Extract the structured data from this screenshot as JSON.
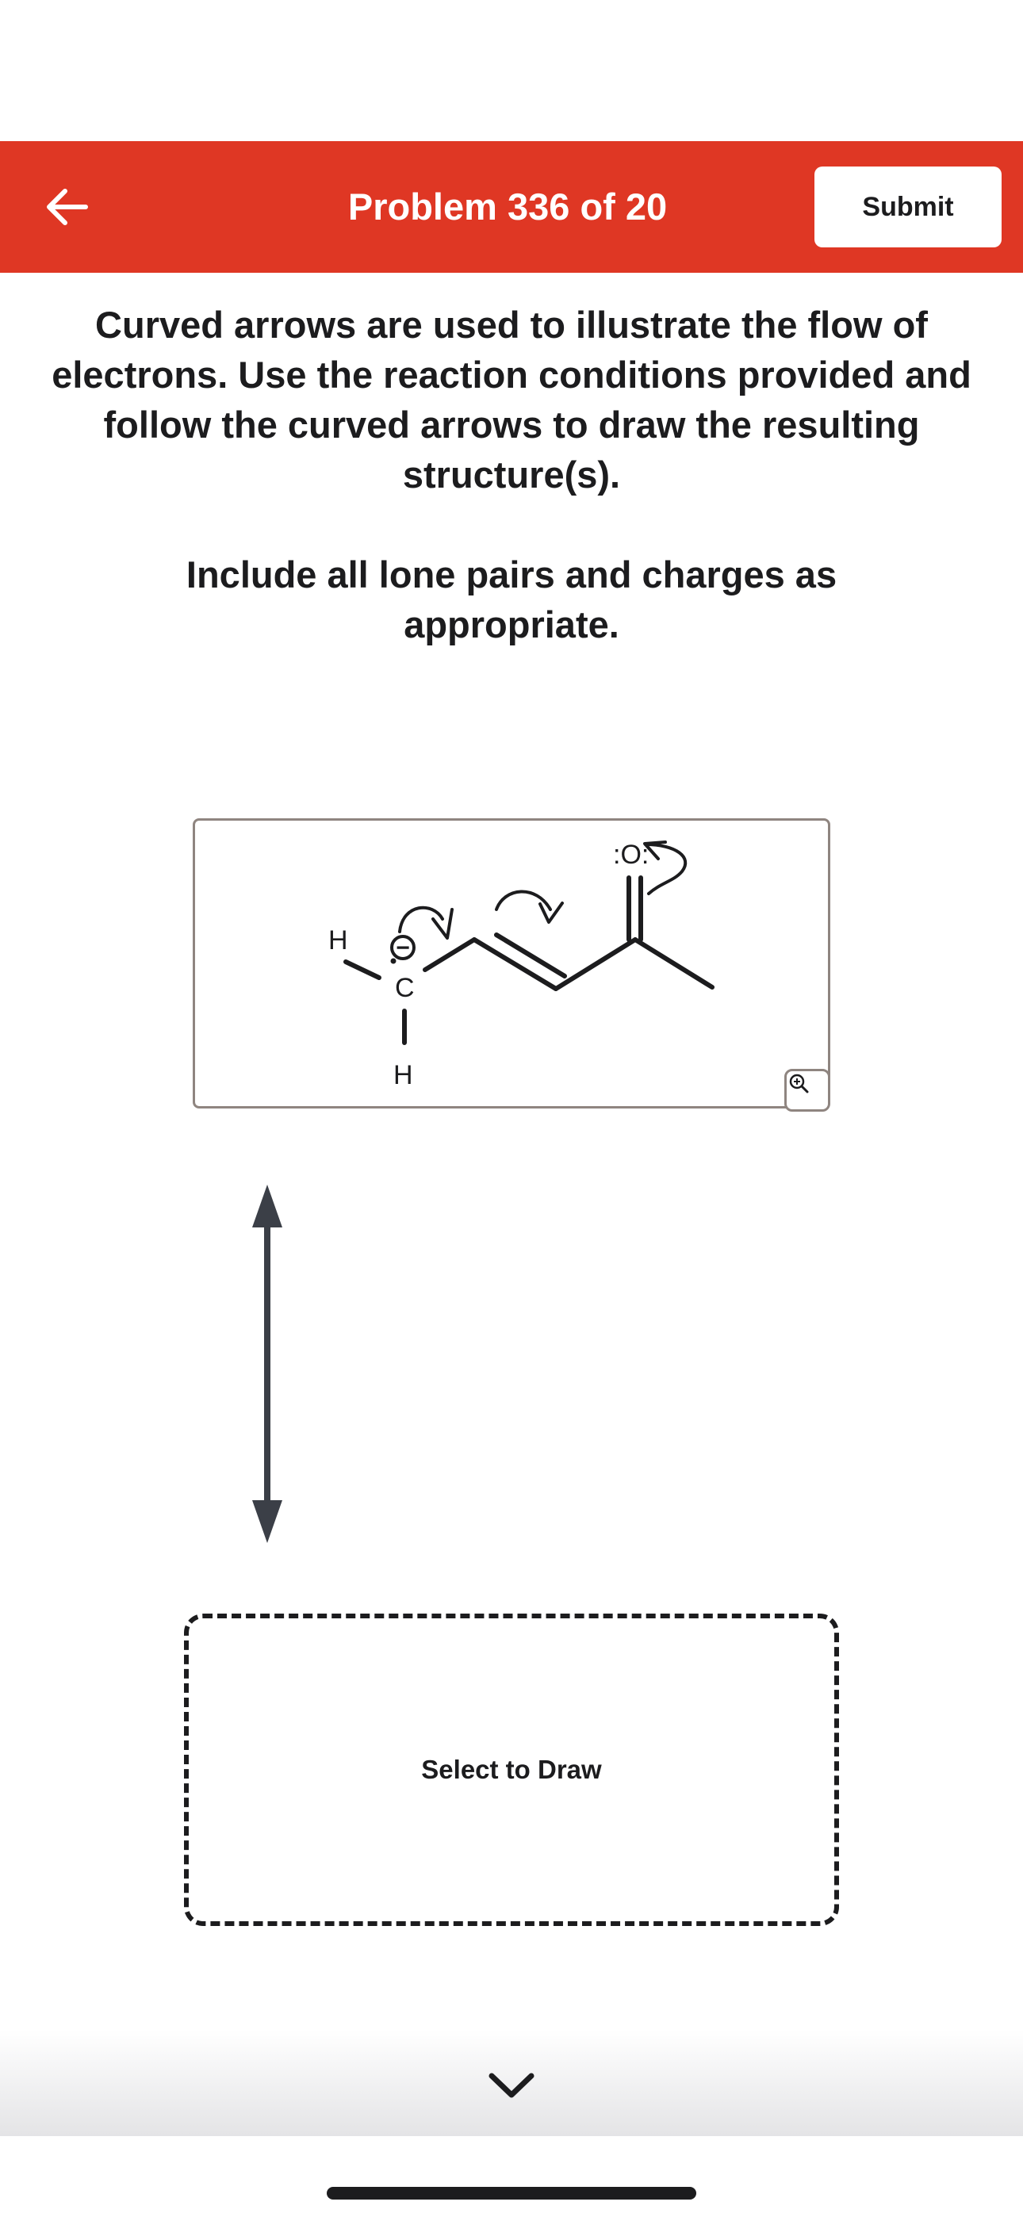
{
  "header": {
    "title": "Problem 336 of 20",
    "submit_label": "Submit",
    "background_color": "#df3724",
    "back_icon": "arrow-left-icon"
  },
  "instructions": {
    "main": "Curved arrows are used to illustrate the flow of electrons. Use the reaction conditions provided and follow the curved arrows to draw the resulting structure(s).",
    "note": "Include all lone pairs and charges as appropriate."
  },
  "reactant": {
    "atoms": {
      "h_left": "H",
      "c_center": "C",
      "h_bottom": "H",
      "oxygen": ":O:"
    },
    "charge": "−",
    "zoom_icon": "zoom-in-icon"
  },
  "reaction_arrow_icon": "double-headed-arrow-icon",
  "draw_area": {
    "label": "Select to Draw"
  },
  "footer": {
    "chevron_icon": "chevron-down-icon"
  }
}
